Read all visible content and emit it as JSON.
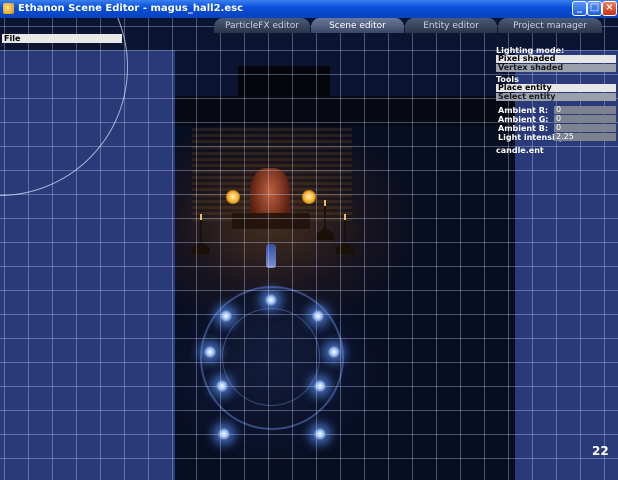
{
  "window": {
    "title": "Ethanon Scene Editor - magus_hall2.esc",
    "minimize_label": "_",
    "maximize_label": "□",
    "close_label": "×"
  },
  "tabs": [
    {
      "label": "ParticleFX editor",
      "active": false
    },
    {
      "label": "Scene editor",
      "active": true
    },
    {
      "label": "Entity editor",
      "active": false
    },
    {
      "label": "Project manager",
      "active": false
    }
  ],
  "menu": {
    "file_label": "File"
  },
  "panel": {
    "lighting_mode_label": "Lighting mode:",
    "lighting_options": [
      {
        "label": "Pixel shaded",
        "selected": true
      },
      {
        "label": "Vertex shaded",
        "selected": false
      }
    ],
    "tools_label": "Tools",
    "tool_options": [
      {
        "label": "Place entity",
        "selected": true
      },
      {
        "label": "Select entity",
        "selected": false
      }
    ],
    "ambient": [
      {
        "label": "Ambient R:",
        "value": "0"
      },
      {
        "label": "Ambient G:",
        "value": "0"
      },
      {
        "label": "Ambient B:",
        "value": "0"
      },
      {
        "label": "Light intensity:",
        "value": "2.25"
      }
    ],
    "current_entity": "candle.ent"
  },
  "fps": "22"
}
